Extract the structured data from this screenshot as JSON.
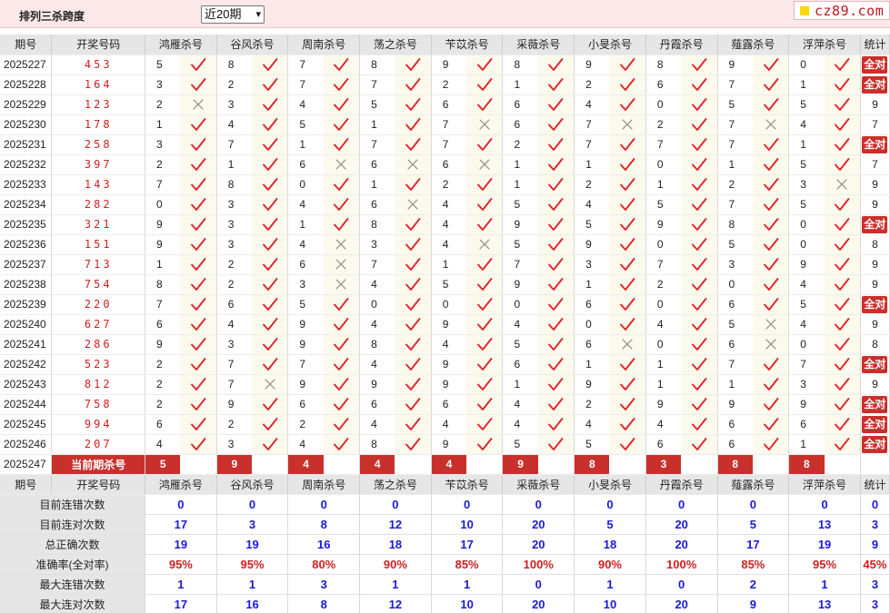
{
  "page": {
    "title": "排列三杀跨度",
    "period_select": "近20期",
    "logo_text": "cz89.com"
  },
  "columns": {
    "period": "期号",
    "draw": "开奖号码",
    "experts": [
      "鸿雁杀号",
      "谷风杀号",
      "周南杀号",
      "荡之杀号",
      "苄苡杀号",
      "采薇杀号",
      "小旻杀号",
      "丹霞杀号",
      "薤露杀号",
      "浮萍杀号"
    ],
    "stat": "统计"
  },
  "all_correct_label": "全对",
  "rows": [
    {
      "period": "2025227",
      "draw": "453",
      "kills": [
        5,
        8,
        7,
        8,
        9,
        8,
        9,
        8,
        9,
        0
      ],
      "hits": [
        1,
        1,
        1,
        1,
        1,
        1,
        1,
        1,
        1,
        1
      ],
      "stat": "全对"
    },
    {
      "period": "2025228",
      "draw": "164",
      "kills": [
        3,
        2,
        7,
        7,
        2,
        1,
        2,
        6,
        7,
        1
      ],
      "hits": [
        1,
        1,
        1,
        1,
        1,
        1,
        1,
        1,
        1,
        1
      ],
      "stat": "全对"
    },
    {
      "period": "2025229",
      "draw": "123",
      "kills": [
        2,
        3,
        4,
        5,
        6,
        6,
        4,
        0,
        5,
        5
      ],
      "hits": [
        0,
        1,
        1,
        1,
        1,
        1,
        1,
        1,
        1,
        1
      ],
      "stat": "9"
    },
    {
      "period": "2025230",
      "draw": "178",
      "kills": [
        1,
        4,
        5,
        1,
        7,
        6,
        7,
        2,
        7,
        4
      ],
      "hits": [
        1,
        1,
        1,
        1,
        0,
        1,
        0,
        1,
        0,
        1
      ],
      "stat": "7"
    },
    {
      "period": "2025231",
      "draw": "258",
      "kills": [
        3,
        7,
        1,
        7,
        7,
        2,
        7,
        7,
        7,
        1
      ],
      "hits": [
        1,
        1,
        1,
        1,
        1,
        1,
        1,
        1,
        1,
        1
      ],
      "stat": "全对"
    },
    {
      "period": "2025232",
      "draw": "397",
      "kills": [
        2,
        1,
        6,
        6,
        6,
        1,
        1,
        0,
        1,
        5
      ],
      "hits": [
        1,
        1,
        0,
        0,
        0,
        1,
        1,
        1,
        1,
        1
      ],
      "stat": "7"
    },
    {
      "period": "2025233",
      "draw": "143",
      "kills": [
        7,
        8,
        0,
        1,
        2,
        1,
        2,
        1,
        2,
        3
      ],
      "hits": [
        1,
        1,
        1,
        1,
        1,
        1,
        1,
        1,
        1,
        0
      ],
      "stat": "9"
    },
    {
      "period": "2025234",
      "draw": "282",
      "kills": [
        0,
        3,
        4,
        6,
        4,
        5,
        4,
        5,
        7,
        5
      ],
      "hits": [
        1,
        1,
        1,
        0,
        1,
        1,
        1,
        1,
        1,
        1
      ],
      "stat": "9"
    },
    {
      "period": "2025235",
      "draw": "321",
      "kills": [
        9,
        3,
        1,
        8,
        4,
        9,
        5,
        9,
        8,
        0
      ],
      "hits": [
        1,
        1,
        1,
        1,
        1,
        1,
        1,
        1,
        1,
        1
      ],
      "stat": "全对"
    },
    {
      "period": "2025236",
      "draw": "151",
      "kills": [
        9,
        3,
        4,
        3,
        4,
        5,
        9,
        0,
        5,
        0
      ],
      "hits": [
        1,
        1,
        0,
        1,
        0,
        1,
        1,
        1,
        1,
        1
      ],
      "stat": "8"
    },
    {
      "period": "2025237",
      "draw": "713",
      "kills": [
        1,
        2,
        6,
        7,
        1,
        7,
        3,
        7,
        3,
        9
      ],
      "hits": [
        1,
        1,
        0,
        1,
        1,
        1,
        1,
        1,
        1,
        1
      ],
      "stat": "9"
    },
    {
      "period": "2025238",
      "draw": "754",
      "kills": [
        8,
        2,
        3,
        4,
        5,
        9,
        1,
        2,
        0,
        4
      ],
      "hits": [
        1,
        1,
        0,
        1,
        1,
        1,
        1,
        1,
        1,
        1
      ],
      "stat": "9"
    },
    {
      "period": "2025239",
      "draw": "220",
      "kills": [
        7,
        6,
        5,
        0,
        0,
        0,
        6,
        0,
        6,
        5
      ],
      "hits": [
        1,
        1,
        1,
        1,
        1,
        1,
        1,
        1,
        1,
        1
      ],
      "stat": "全对"
    },
    {
      "period": "2025240",
      "draw": "627",
      "kills": [
        6,
        4,
        9,
        4,
        9,
        4,
        0,
        4,
        5,
        4
      ],
      "hits": [
        1,
        1,
        1,
        1,
        1,
        1,
        1,
        1,
        0,
        1
      ],
      "stat": "9"
    },
    {
      "period": "2025241",
      "draw": "286",
      "kills": [
        9,
        3,
        9,
        8,
        4,
        5,
        6,
        0,
        6,
        0
      ],
      "hits": [
        1,
        1,
        1,
        1,
        1,
        1,
        0,
        1,
        0,
        1
      ],
      "stat": "8"
    },
    {
      "period": "2025242",
      "draw": "523",
      "kills": [
        2,
        7,
        7,
        4,
        9,
        6,
        1,
        1,
        7,
        7
      ],
      "hits": [
        1,
        1,
        1,
        1,
        1,
        1,
        1,
        1,
        1,
        1
      ],
      "stat": "全对"
    },
    {
      "period": "2025243",
      "draw": "812",
      "kills": [
        2,
        7,
        9,
        9,
        9,
        1,
        9,
        1,
        1,
        3
      ],
      "hits": [
        1,
        0,
        1,
        1,
        1,
        1,
        1,
        1,
        1,
        1
      ],
      "stat": "9"
    },
    {
      "period": "2025244",
      "draw": "758",
      "kills": [
        2,
        9,
        6,
        6,
        6,
        4,
        2,
        9,
        9,
        9
      ],
      "hits": [
        1,
        1,
        1,
        1,
        1,
        1,
        1,
        1,
        1,
        1
      ],
      "stat": "全对"
    },
    {
      "period": "2025245",
      "draw": "994",
      "kills": [
        6,
        2,
        2,
        4,
        4,
        4,
        4,
        4,
        6,
        6
      ],
      "hits": [
        1,
        1,
        1,
        1,
        1,
        1,
        1,
        1,
        1,
        1
      ],
      "stat": "全对"
    },
    {
      "period": "2025246",
      "draw": "207",
      "kills": [
        4,
        3,
        4,
        8,
        9,
        5,
        5,
        6,
        6,
        1
      ],
      "hits": [
        1,
        1,
        1,
        1,
        1,
        1,
        1,
        1,
        1,
        1
      ],
      "stat": "全对"
    }
  ],
  "current": {
    "period": "2025247",
    "label": "当前期杀号",
    "kills": [
      5,
      9,
      4,
      4,
      4,
      9,
      8,
      3,
      8,
      8
    ]
  },
  "summary_header": {
    "period": "期号",
    "draw": "开奖号码"
  },
  "summary": [
    {
      "label": "目前连错次数",
      "values": [
        "0",
        "0",
        "0",
        "0",
        "0",
        "0",
        "0",
        "0",
        "0",
        "0"
      ],
      "stat": "0",
      "color": "blue"
    },
    {
      "label": "目前连对次数",
      "values": [
        "17",
        "3",
        "8",
        "12",
        "10",
        "20",
        "5",
        "20",
        "5",
        "13"
      ],
      "stat": "3",
      "color": "blue"
    },
    {
      "label": "总正确次数",
      "values": [
        "19",
        "19",
        "16",
        "18",
        "17",
        "20",
        "18",
        "20",
        "17",
        "19"
      ],
      "stat": "9",
      "color": "blue"
    },
    {
      "label": "准确率(全对率)",
      "values": [
        "95%",
        "95%",
        "80%",
        "90%",
        "85%",
        "100%",
        "90%",
        "100%",
        "85%",
        "95%"
      ],
      "stat": "45%",
      "color": "red"
    },
    {
      "label": "最大连错次数",
      "values": [
        "1",
        "1",
        "3",
        "1",
        "1",
        "0",
        "1",
        "0",
        "2",
        "1"
      ],
      "stat": "3",
      "color": "blue"
    },
    {
      "label": "最大连对次数",
      "values": [
        "17",
        "16",
        "8",
        "12",
        "10",
        "20",
        "10",
        "20",
        "9",
        "13"
      ],
      "stat": "3",
      "color": "blue"
    }
  ],
  "colors": {
    "accent_red": "#c9302c",
    "check_red": "#e0242a",
    "cross_gray": "#8a8a8a",
    "header_gray": "#e6e6e6",
    "mark_cell_bg": "#fcfaec",
    "summary_blue": "#1a1ad6",
    "top_bar_pink": "#fbe9ea"
  },
  "icons": {
    "hit": "check-icon",
    "miss": "cross-icon",
    "select_arrow": "chevron-down-icon"
  }
}
